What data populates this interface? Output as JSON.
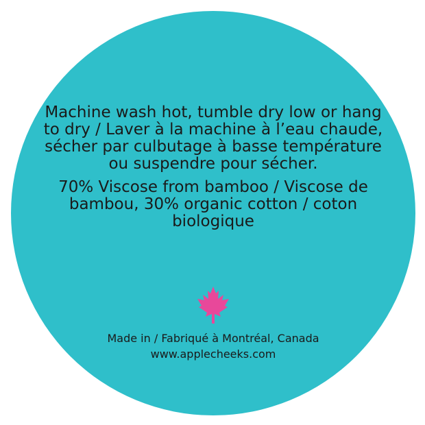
{
  "label": {
    "care_instructions": "Machine wash hot, tumble dry low or hang to dry / Laver à la machine à l’eau chaude, sécher par culbutage à basse température ou suspendre pour sécher.",
    "composition": "70% Viscose from bamboo / Viscose de bambou, 30% organic cotton / coton biologique",
    "origin": "Made in / Fabriqué à Montréal, Canada",
    "website": "www.applecheeks.com"
  },
  "icons": {
    "leaf": "maple-leaf-icon"
  },
  "colors": {
    "circle": "#2fbfca",
    "text": "#1a1a1a",
    "leaf": "#e8489a",
    "background": "#ffffff"
  }
}
